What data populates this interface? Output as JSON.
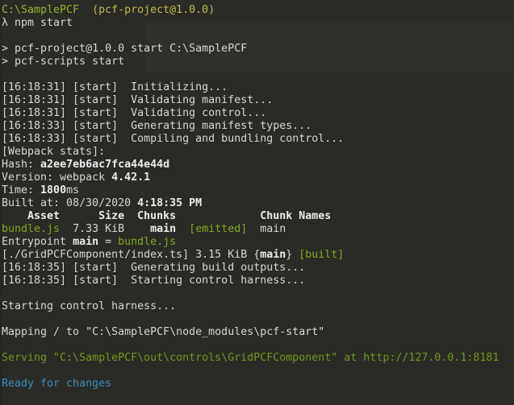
{
  "terminal": {
    "lines": [
      [
        {
          "t": "C:\\SamplePCF",
          "c": "prompt"
        },
        {
          "t": "  "
        },
        {
          "t": "(pcf-project@1.0.0)",
          "c": "yellow"
        }
      ],
      [
        {
          "t": "λ npm start"
        }
      ],
      [],
      [
        {
          "t": "> pcf-project@1.0.0 start C:\\SamplePCF"
        }
      ],
      [
        {
          "t": "> pcf-scripts start"
        }
      ],
      [],
      [
        {
          "t": "[16:18:31] [start]  Initializing..."
        }
      ],
      [
        {
          "t": "[16:18:31] [start]  Validating manifest..."
        }
      ],
      [
        {
          "t": "[16:18:31] [start]  Validating control..."
        }
      ],
      [
        {
          "t": "[16:18:33] [start]  Generating manifest types..."
        }
      ],
      [
        {
          "t": "[16:18:33] [start]  Compiling and bundling control..."
        }
      ],
      [
        {
          "t": "[Webpack stats]:"
        }
      ],
      [
        {
          "t": "Hash: "
        },
        {
          "t": "a2ee7eb6ac7fca44e44d",
          "c": "b"
        }
      ],
      [
        {
          "t": "Version: webpack "
        },
        {
          "t": "4.42.1",
          "c": "b"
        }
      ],
      [
        {
          "t": "Time: "
        },
        {
          "t": "1800",
          "c": "b"
        },
        {
          "t": "ms"
        }
      ],
      [
        {
          "t": "Built at: 08/30/2020 "
        },
        {
          "t": "4:18:35 PM",
          "c": "b"
        }
      ],
      [
        {
          "t": "    Asset      Size  Chunks             Chunk Names",
          "c": "b"
        }
      ],
      [
        {
          "t": "bundle.js",
          "c": "green"
        },
        {
          "t": "  7.33 KiB    "
        },
        {
          "t": "main",
          "c": "b"
        },
        {
          "t": "  "
        },
        {
          "t": "[emitted]",
          "c": "green"
        },
        {
          "t": "  main"
        }
      ],
      [
        {
          "t": "Entrypoint "
        },
        {
          "t": "main",
          "c": "b"
        },
        {
          "t": " = "
        },
        {
          "t": "bundle.js",
          "c": "green"
        }
      ],
      [
        {
          "t": "[./GridPCFComponent/index.ts] 3.15 KiB {"
        },
        {
          "t": "main",
          "c": "b"
        },
        {
          "t": "} "
        },
        {
          "t": "[built]",
          "c": "green"
        }
      ],
      [
        {
          "t": "[16:18:35] [start]  Generating build outputs..."
        }
      ],
      [
        {
          "t": "[16:18:35] [start]  Starting control harness..."
        }
      ],
      [],
      [
        {
          "t": "Starting control harness..."
        }
      ],
      [],
      [
        {
          "t": "Mapping / to \"C:\\SamplePCF\\node_modules\\pcf-start\""
        }
      ],
      [],
      [
        {
          "t": "Serving \"C:\\SamplePCF\\out\\controls\\GridPCFComponent\" at http://127.0.0.1:8181",
          "c": "serve"
        }
      ],
      [],
      [
        {
          "t": "Ready for changes",
          "c": "blue"
        }
      ]
    ]
  },
  "colors": {
    "background": "#2a2a26",
    "text": "#d6d6d2",
    "prompt_path": "#8fb52c",
    "project": "#c2b84a",
    "green": "#7cab1e",
    "ready": "#3a8fc0"
  }
}
